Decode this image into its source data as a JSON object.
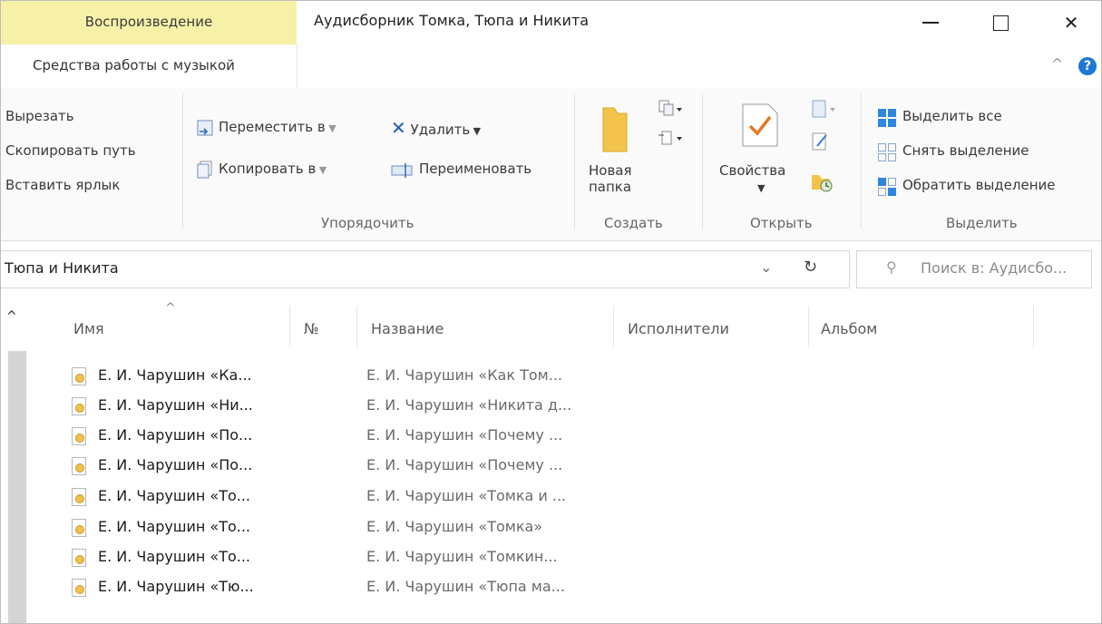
{
  "titlebar": {
    "context_tab": "Воспроизведение",
    "title": "Аудисборник Томка, Тюпа и Никита",
    "close_glyph": "✕"
  },
  "tabs": {
    "tools_tab": "Средства работы с музыкой",
    "collapse_glyph": "^",
    "help_glyph": "?"
  },
  "ribbon": {
    "clipboard": {
      "cut": "Вырезать",
      "copy_path": "Скопировать путь",
      "paste_shortcut": "Вставить ярлык"
    },
    "organize": {
      "move_to": "Переместить в",
      "copy_to": "Копировать в",
      "delete": "Удалить",
      "rename": "Переименовать",
      "group_label": "Упорядочить"
    },
    "create": {
      "new_folder_line1": "Новая",
      "new_folder_line2": "папка",
      "group_label": "Создать"
    },
    "open": {
      "properties": "Свойства",
      "group_label": "Открыть"
    },
    "select": {
      "select_all": "Выделить все",
      "select_none": "Снять выделение",
      "invert": "Обратить выделение",
      "group_label": "Выделить"
    }
  },
  "address": {
    "path": "Тюпа и Никита",
    "search_placeholder": "Поиск в: Аудисбо..."
  },
  "columns": {
    "name": "Имя",
    "number": "№",
    "title": "Название",
    "artists": "Исполнители",
    "album": "Альбом"
  },
  "files": [
    {
      "name": "Е. И. Чарушин «Ка...",
      "title": "Е. И. Чарушин «Как Том..."
    },
    {
      "name": "Е. И. Чарушин «Ни...",
      "title": "Е. И. Чарушин «Никита д..."
    },
    {
      "name": "Е. И. Чарушин «По...",
      "title": "Е. И. Чарушин «Почему ..."
    },
    {
      "name": "Е. И. Чарушин «По...",
      "title": "Е. И. Чарушин «Почему ..."
    },
    {
      "name": "Е. И. Чарушин «То...",
      "title": "Е. И. Чарушин «Томка и ..."
    },
    {
      "name": "Е. И. Чарушин «То...",
      "title": "Е. И. Чарушин «Томка»"
    },
    {
      "name": "Е. И. Чарушин «То...",
      "title": "Е. И. Чарушин «Томкин..."
    },
    {
      "name": "Е. И. Чарушин «Тю...",
      "title": "Е. И. Чарушин «Тюпа ма..."
    }
  ],
  "colors": {
    "context_tab": "#f7f1a8",
    "accent": "#1e78d4",
    "audio_icon": "#f0c24a"
  }
}
